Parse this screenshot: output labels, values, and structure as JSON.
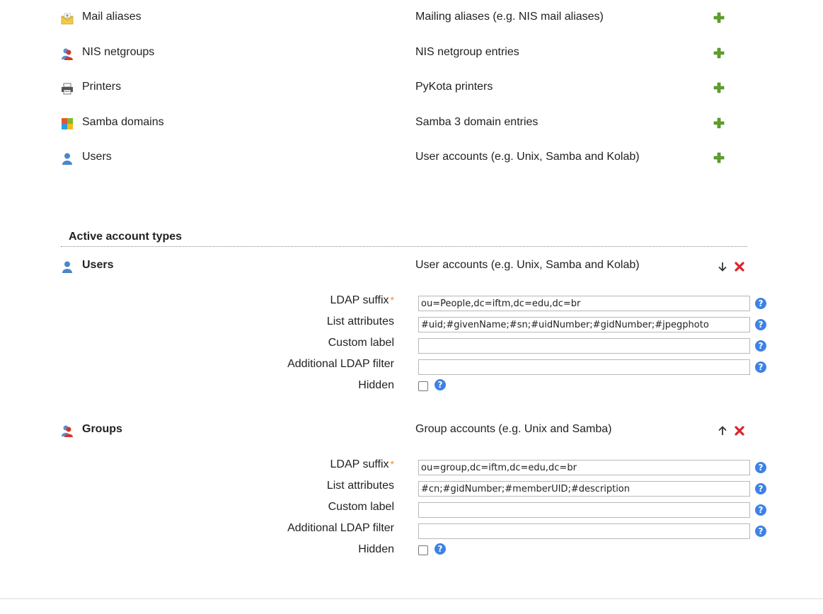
{
  "available_types": [
    {
      "name": "Mail aliases",
      "description": "Mailing aliases (e.g. NIS mail aliases)",
      "icon": "mail-icon"
    },
    {
      "name": "NIS netgroups",
      "description": "NIS netgroup entries",
      "icon": "netgroup-icon"
    },
    {
      "name": "Printers",
      "description": "PyKota printers",
      "icon": "printer-icon"
    },
    {
      "name": "Samba domains",
      "description": "Samba 3 domain entries",
      "icon": "samba-domain-icon"
    },
    {
      "name": "Users",
      "description": "User accounts (e.g. Unix, Samba and Kolab)",
      "icon": "user-icon"
    }
  ],
  "active_section": {
    "title": "Active account types"
  },
  "active_types": [
    {
      "name": "Users",
      "description": "User accounts (e.g. Unix, Samba and Kolab)",
      "icon": "user-icon",
      "move_icon": "arrow-down-icon",
      "labels": {
        "ldap_suffix": "LDAP suffix",
        "required_mark": "*",
        "list_attributes": "List attributes",
        "custom_label": "Custom label",
        "additional_filter": "Additional LDAP filter",
        "hidden": "Hidden"
      },
      "values": {
        "ldap_suffix": "ou=People,dc=iftm,dc=edu,dc=br",
        "list_attributes": "#uid;#givenName;#sn;#uidNumber;#gidNumber;#jpegphoto",
        "custom_label": "",
        "additional_filter": ""
      },
      "hidden_checked": false
    },
    {
      "name": "Groups",
      "description": "Group accounts (e.g. Unix and Samba)",
      "icon": "group-icon",
      "move_icon": "arrow-up-icon",
      "labels": {
        "ldap_suffix": "LDAP suffix",
        "required_mark": "*",
        "list_attributes": "List attributes",
        "custom_label": "Custom label",
        "additional_filter": "Additional LDAP filter",
        "hidden": "Hidden"
      },
      "values": {
        "ldap_suffix": "ou=group,dc=iftm,dc=edu,dc=br",
        "list_attributes": "#cn;#gidNumber;#memberUID;#description",
        "custom_label": "",
        "additional_filter": ""
      },
      "hidden_checked": false
    }
  ],
  "help_glyph": "?",
  "colors": {
    "add": "#5fa12a",
    "delete": "#d9262b",
    "help": "#3d82e6",
    "required": "#f48a1d"
  }
}
